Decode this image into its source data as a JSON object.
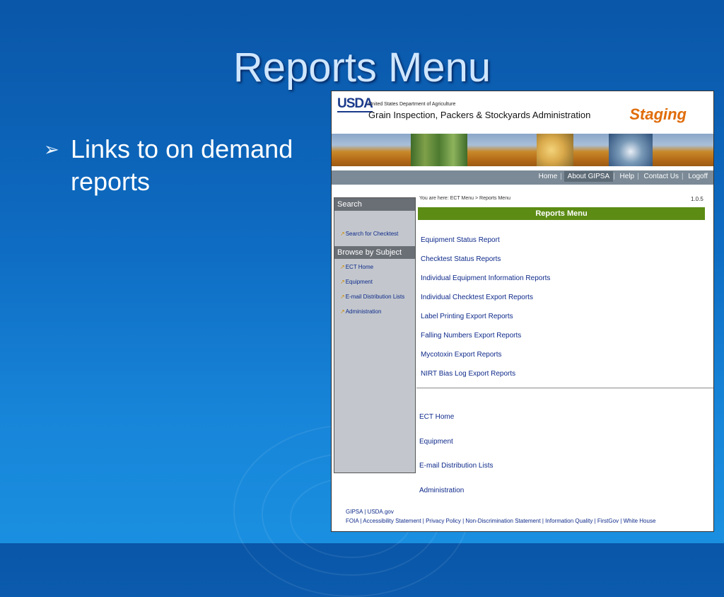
{
  "slide": {
    "title": "Reports Menu",
    "bullet_marker": "➢",
    "bullet_text": "Links to on demand reports"
  },
  "colors": {
    "accent": "#5c8c14",
    "staging": "#e06c0a",
    "link": "#0e2a8a",
    "nav": "#7b8a96"
  },
  "header": {
    "logo": "USDA",
    "department": "United States Department of Agriculture",
    "agency": "Grain Inspection, Packers & Stockyards Administration",
    "environment": "Staging"
  },
  "nav": {
    "items": [
      {
        "label": "Home"
      },
      {
        "label": "About GIPSA"
      },
      {
        "label": "Help"
      },
      {
        "label": "Contact Us"
      },
      {
        "label": "Logoff"
      }
    ]
  },
  "sidebar": {
    "search_heading": "Search",
    "search_link": "Search for Checktest",
    "browse_heading": "Browse by Subject",
    "browse_links": [
      "ECT Home",
      "Equipment",
      "E-mail Distribution Lists",
      "Administration"
    ]
  },
  "content": {
    "breadcrumb": "You are here: ECT Menu > Reports Menu",
    "version": "1.0.5",
    "heading": "Reports Menu",
    "reports": [
      "Equipment Status Report",
      "Checktest Status Reports",
      "Individual Equipment Information Reports",
      "Individual Checktest Export Reports",
      "Label Printing Export Reports",
      "Falling Numbers Export Reports",
      "Mycotoxin Export Reports",
      "NIRT Bias Log Export Reports"
    ],
    "bottom_links": [
      "ECT Home",
      "Equipment",
      "E-mail Distribution Lists",
      "Administration"
    ]
  },
  "footer": {
    "line1": "GIPSA | USDA.gov",
    "line2": "FOIA | Accessibility Statement | Privacy Policy | Non-Discrimination Statement | Information Quality | FirstGov | White House"
  }
}
